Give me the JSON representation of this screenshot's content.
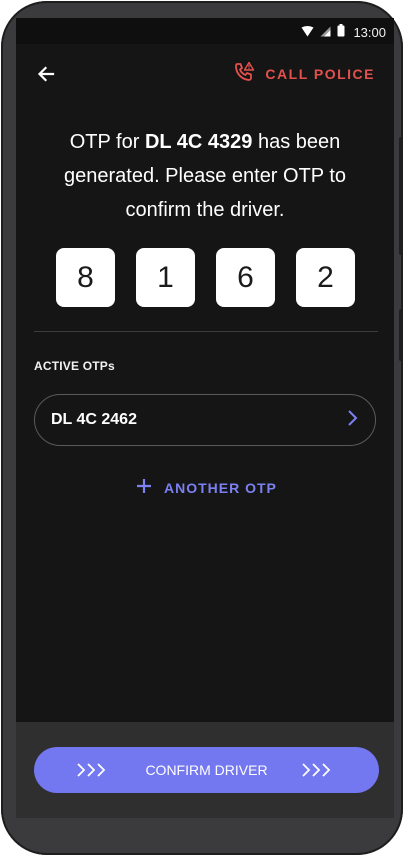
{
  "status_bar": {
    "time": "13:00",
    "icons": [
      "wifi-icon",
      "signal-icon",
      "battery-icon"
    ]
  },
  "toolbar": {
    "back_icon": "arrow-left-icon",
    "call_police_label": "CALL POLICE",
    "call_police_icon": "phone-alert-icon"
  },
  "message": {
    "prefix": "OTP for ",
    "plate": "DL 4C 4329",
    "suffix": " has been generated. Please enter OTP to confirm the driver."
  },
  "otp_digits": [
    "8",
    "1",
    "6",
    "2"
  ],
  "active_otps": {
    "label": "ACTIVE OTPs",
    "items": [
      {
        "plate": "DL 4C 2462",
        "icon": "chevron-right-icon"
      }
    ]
  },
  "another_otp": {
    "label": "ANOTHER OTP",
    "icon": "plus-icon"
  },
  "confirm": {
    "label": "CONFIRM DRIVER",
    "icon": "triple-chevron-right-icon"
  },
  "colors": {
    "screen_bg": "#151515",
    "accent": "#7377f0",
    "alert": "#e3514d",
    "bottom_panel": "#2f2f2f"
  }
}
